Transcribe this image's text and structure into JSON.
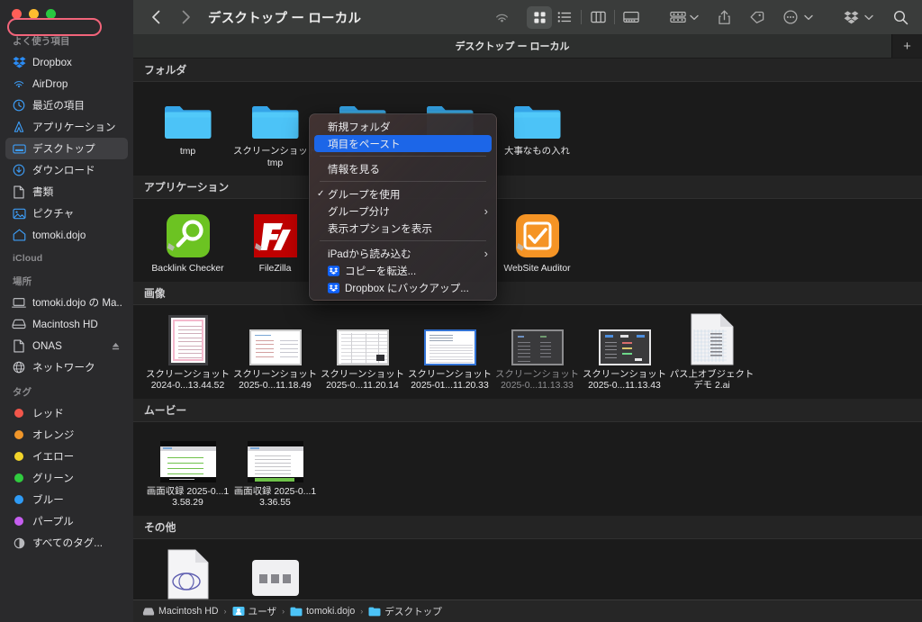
{
  "window": {
    "title": "デスクトップ ー ローカル",
    "tab_label": "デスクトップ ー ローカル",
    "new_tab_label": "+",
    "back_icon": "chevron-left-icon",
    "forward_icon": "chevron-right-icon"
  },
  "toolbar": {
    "items": [
      {
        "name": "airdrop-icon",
        "label": "AirDrop"
      },
      {
        "name": "icon-view-button",
        "label": "アイコン表示"
      },
      {
        "name": "list-view-button",
        "label": "リスト表示"
      },
      {
        "name": "column-view-button",
        "label": "カラム表示"
      },
      {
        "name": "gallery-view-button",
        "label": "ギャラリー表示"
      },
      {
        "name": "group-by-button",
        "label": "グループ分け"
      },
      {
        "name": "share-button",
        "label": "共有"
      },
      {
        "name": "tag-button",
        "label": "タグ"
      },
      {
        "name": "more-actions-button",
        "label": "その他"
      },
      {
        "name": "dropbox-button",
        "label": "Dropbox"
      },
      {
        "name": "search-button",
        "label": "検索"
      }
    ]
  },
  "sidebar": {
    "sections": [
      {
        "title": "よく使う項目",
        "items": [
          {
            "label": "Dropbox",
            "icon": "dropbox-icon",
            "selected": false
          },
          {
            "label": "AirDrop",
            "icon": "airdrop-icon",
            "selected": false
          },
          {
            "label": "最近の項目",
            "icon": "clock-icon",
            "selected": false
          },
          {
            "label": "アプリケーション",
            "icon": "applications-icon",
            "selected": false
          },
          {
            "label": "デスクトップ",
            "icon": "desktop-icon",
            "selected": true
          },
          {
            "label": "ダウンロード",
            "icon": "downloads-icon",
            "selected": false
          },
          {
            "label": "書類",
            "icon": "document-icon",
            "selected": false
          },
          {
            "label": "ピクチャ",
            "icon": "pictures-icon",
            "selected": false
          },
          {
            "label": "tomoki.dojo",
            "icon": "home-icon",
            "selected": false
          }
        ]
      },
      {
        "title": "iCloud",
        "items": []
      },
      {
        "title": "場所",
        "items": [
          {
            "label": "tomoki.dojo の Ma...",
            "icon": "laptop-icon",
            "selected": false
          },
          {
            "label": "Macintosh HD",
            "icon": "harddisk-icon",
            "selected": false
          },
          {
            "label": "ONAS",
            "icon": "document-icon",
            "selected": false,
            "eject": true
          },
          {
            "label": "ネットワーク",
            "icon": "network-globe-icon",
            "selected": false
          }
        ]
      },
      {
        "title": "タグ",
        "items": [
          {
            "label": "レッド",
            "icon": "tag-dot-icon",
            "color": "#f2564b"
          },
          {
            "label": "オレンジ",
            "icon": "tag-dot-icon",
            "color": "#f0962a"
          },
          {
            "label": "イエロー",
            "icon": "tag-dot-icon",
            "color": "#f2d42a"
          },
          {
            "label": "グリーン",
            "icon": "tag-dot-icon",
            "color": "#30cc3f"
          },
          {
            "label": "ブルー",
            "icon": "tag-dot-icon",
            "color": "#2f9bf5"
          },
          {
            "label": "パープル",
            "icon": "tag-dot-icon",
            "color": "#c65ef0"
          },
          {
            "label": "すべてのタグ...",
            "icon": "all-tags-icon",
            "color": ""
          }
        ]
      }
    ]
  },
  "content": {
    "groups": [
      {
        "title": "フォルダ",
        "kind": "folder",
        "items": [
          {
            "label": "tmp"
          },
          {
            "label": "スクリーンショット tmp"
          },
          {
            "label": ""
          },
          {
            "label": ""
          },
          {
            "label": "大事なもの入れ"
          }
        ]
      },
      {
        "title": "アプリケーション",
        "kind": "app",
        "items": [
          {
            "label": "Backlink Checker",
            "app": "backlink-checker"
          },
          {
            "label": "FileZilla",
            "app": "filezilla"
          },
          {
            "label": "",
            "app": "hidden"
          },
          {
            "label": "",
            "app": "hidden"
          },
          {
            "label": "WebSite Auditor",
            "app": "website-auditor"
          }
        ]
      },
      {
        "title": "画像",
        "kind": "image",
        "items": [
          {
            "label": "スクリーンショット 2024-0...13.44.52",
            "style": "pink",
            "dim": false
          },
          {
            "label": "スクリーンショット 2025-0...11.18.49",
            "style": "light",
            "dim": false
          },
          {
            "label": "スクリーンショット 2025-0...11.20.14",
            "style": "table",
            "dim": false
          },
          {
            "label": "スクリーンショット 2025-01...11.20.33",
            "style": "doc",
            "dim": false
          },
          {
            "label": "スクリーンショット 2025-0...11.13.33",
            "style": "dark",
            "dim": true
          },
          {
            "label": "スクリーンショット 2025-0...11.13.43",
            "style": "dark2",
            "dim": false
          },
          {
            "label": "パス上オブジェクト デモ 2.ai",
            "style": "ai-file",
            "dim": false
          }
        ]
      },
      {
        "title": "ムービー",
        "kind": "movie",
        "items": [
          {
            "label": "画面収録 2025-0...13.58.29"
          },
          {
            "label": "画面収録 2025-0...13.36.55"
          }
        ]
      },
      {
        "title": "その他",
        "kind": "other",
        "items": [
          {
            "label": ""
          },
          {
            "label": ""
          }
        ]
      }
    ]
  },
  "context_menu": {
    "items": [
      {
        "label": "新規フォルダ",
        "type": "plain"
      },
      {
        "label": "項目をペースト",
        "type": "highlighted"
      },
      {
        "label": "__sep__",
        "type": "separator"
      },
      {
        "label": "情報を見る",
        "type": "plain"
      },
      {
        "label": "__sep__",
        "type": "separator"
      },
      {
        "label": "グループを使用",
        "type": "checked"
      },
      {
        "label": "グループ分け",
        "type": "submenu"
      },
      {
        "label": "表示オプションを表示",
        "type": "plain"
      },
      {
        "label": "__sep__",
        "type": "separator"
      },
      {
        "label": "iPadから読み込む",
        "type": "submenu"
      },
      {
        "label": "コピーを転送...",
        "type": "dropbox"
      },
      {
        "label": "Dropbox にバックアップ...",
        "type": "dropbox"
      }
    ],
    "highlight_color": "#1c66e8",
    "annotation_color": "#f2647a"
  },
  "path_bar": {
    "crumbs": [
      {
        "label": "Macintosh HD",
        "icon": "harddisk-icon"
      },
      {
        "label": "ユーザ",
        "icon": "users-folder-icon"
      },
      {
        "label": "tomoki.dojo",
        "icon": "folder-icon"
      },
      {
        "label": "デスクトップ",
        "icon": "folder-icon"
      }
    ],
    "separator": "›"
  }
}
